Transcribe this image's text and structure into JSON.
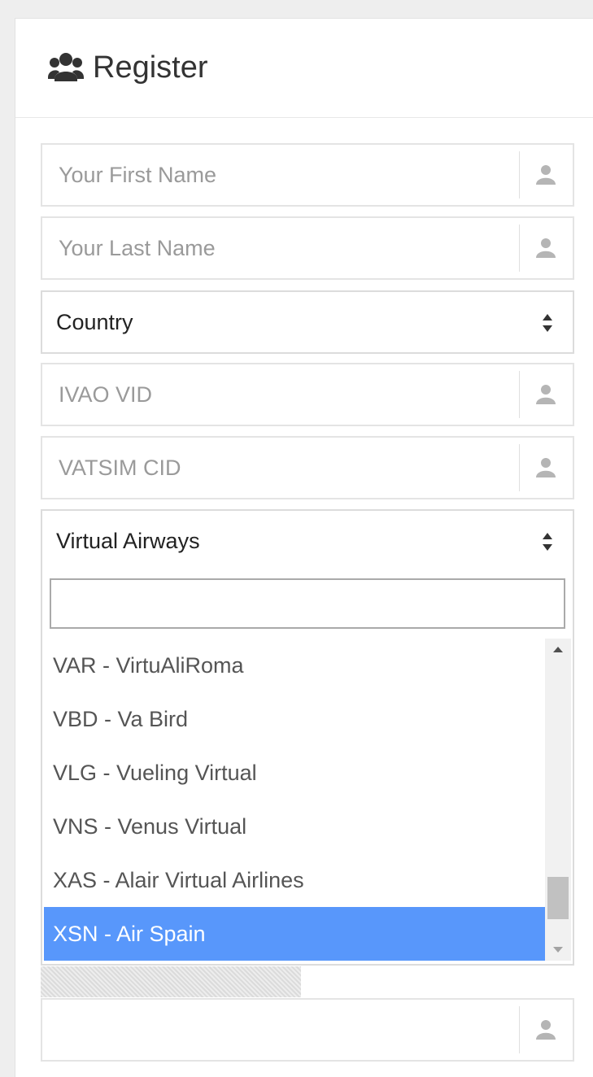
{
  "header": {
    "title": "Register",
    "icon": "users-icon"
  },
  "form": {
    "first_name": {
      "placeholder": "Your First Name",
      "value": "",
      "icon": "user-icon"
    },
    "last_name": {
      "placeholder": "Your Last Name",
      "value": "",
      "icon": "user-icon"
    },
    "country": {
      "value": "Country",
      "icon": "sort-arrows-icon"
    },
    "ivao_vid": {
      "placeholder": "IVAO VID",
      "value": "",
      "icon": "user-icon"
    },
    "vatsim_cid": {
      "placeholder": "VATSIM CID",
      "value": "",
      "icon": "user-icon"
    },
    "virtual_airways": {
      "value": "Virtual Airways",
      "icon": "sort-arrows-icon",
      "search_value": "",
      "options": [
        {
          "label": "VAR - VirtuAliRoma",
          "selected": false
        },
        {
          "label": "VBD - Va Bird",
          "selected": false
        },
        {
          "label": "VLG - Vueling Virtual",
          "selected": false
        },
        {
          "label": "VNS - Venus Virtual",
          "selected": false
        },
        {
          "label": "XAS - Alair Virtual Airlines",
          "selected": false
        },
        {
          "label": "XSN - Air Spain",
          "selected": true
        }
      ],
      "scroll_position": 0.92
    },
    "bottom_field": {
      "placeholder": "",
      "value": "",
      "icon": "user-icon"
    }
  },
  "colors": {
    "selected_option_bg": "#5897fb",
    "icon_grey": "#b5b5b5"
  }
}
